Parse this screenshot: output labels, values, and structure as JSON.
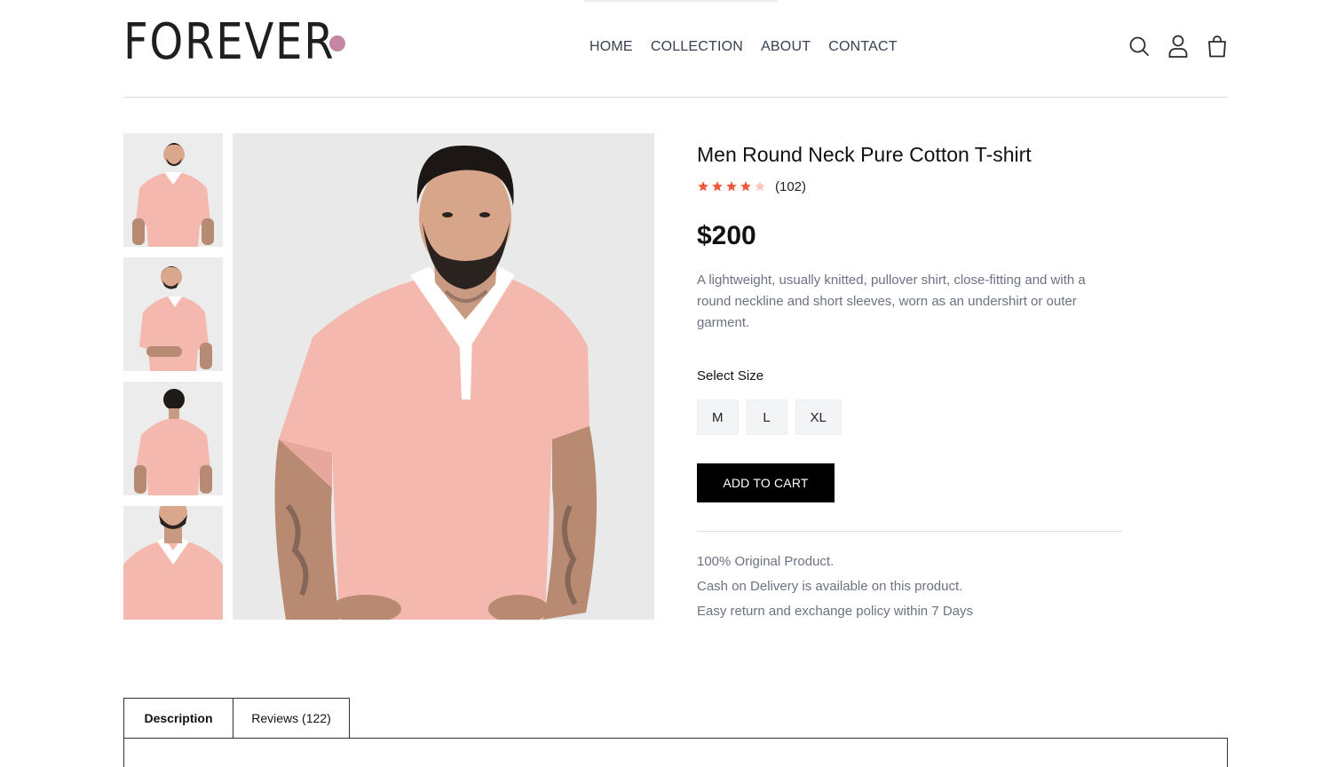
{
  "brand": {
    "logo_text": "FOREVER",
    "accent": "#c586a5"
  },
  "nav": {
    "items": [
      {
        "label": "HOME"
      },
      {
        "label": "COLLECTION"
      },
      {
        "label": "ABOUT"
      },
      {
        "label": "CONTACT"
      }
    ]
  },
  "header_icons": [
    "search-icon",
    "user-icon",
    "shopping-bag-icon"
  ],
  "product": {
    "title": "Men Round Neck Pure Cotton T-shirt",
    "rating": 4,
    "rating_max": 5,
    "rating_count": "(102)",
    "price": "$200",
    "description": "A lightweight, usually knitted, pullover shirt, close-fitting and with a round neckline and short sleeves, worn as an undershirt or outer garment.",
    "size_label": "Select Size",
    "sizes": [
      "M",
      "L",
      "XL"
    ],
    "add_to_cart_label": "ADD TO CART",
    "features": [
      "100% Original Product.",
      "Cash on Delivery is available on this product.",
      "Easy return and exchange policy within 7 Days"
    ],
    "star_color": "#f05a3c",
    "shirt_color": "#f4b8ae"
  },
  "tabs": [
    {
      "label": "Description",
      "active": true
    },
    {
      "label": "Reviews (122)",
      "active": false
    }
  ]
}
